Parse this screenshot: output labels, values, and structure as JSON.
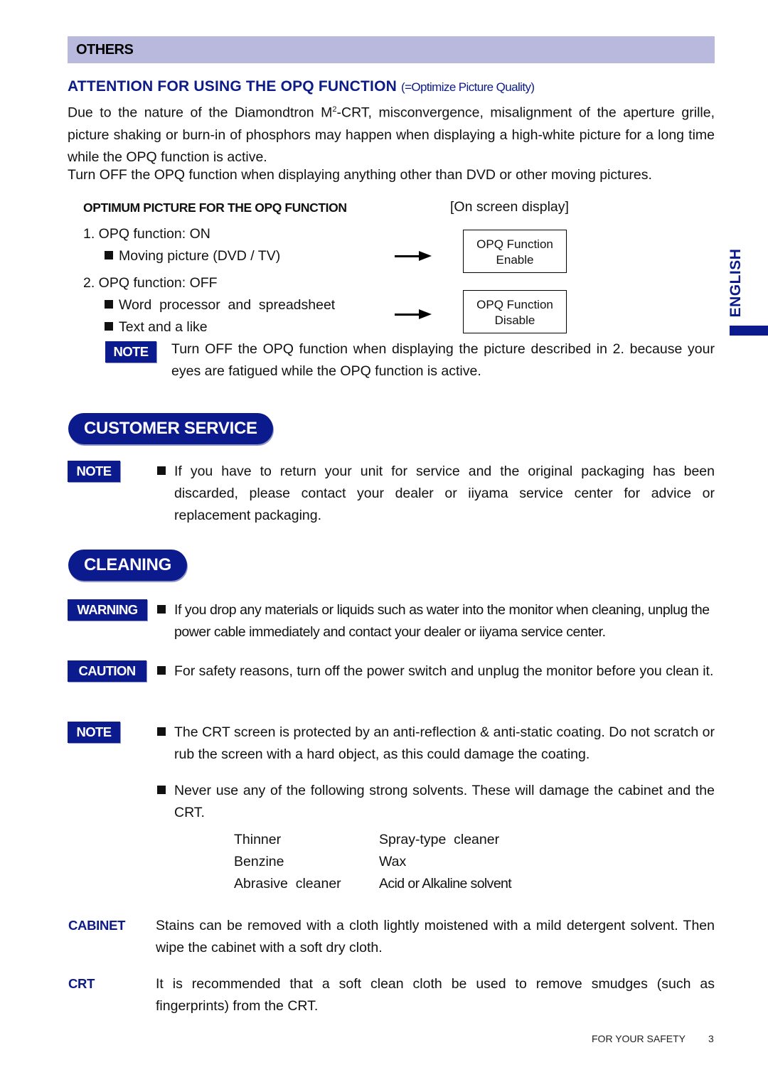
{
  "section": {
    "title": "OTHERS"
  },
  "attention": {
    "title": "ATTENTION FOR USING THE OPQ FUNCTION",
    "subtitle": "(=Optimize Picture Quality)",
    "para1_line1_pre": "Due to the nature of the Diamondtron M",
    "para1_sup": "2",
    "para1_line1_post": "-CRT, misconvergence, misalignment of the aperture grille, picture shaking or burn-in of phosphors may happen when displaying a high-white picture for a long time while the OPQ function is active.",
    "para2": "Turn OFF the OPQ function when displaying anything other than DVD or other moving pictures."
  },
  "optimum": {
    "heading": "OPTIMUM PICTURE FOR THE OPQ FUNCTION",
    "osd_label": "[On screen display]",
    "items": [
      {
        "title": "1.  OPQ function: ON",
        "bullets": [
          "Moving picture (DVD / TV)"
        ],
        "osd_line1": "OPQ Function",
        "osd_line2": "Enable"
      },
      {
        "title": "2.  OPQ function: OFF",
        "bullets": [
          "Word  processor  and  spreadsheet",
          "Text and a like"
        ],
        "osd_line1": "OPQ Function",
        "osd_line2": "Disable"
      }
    ],
    "note_label": "NOTE",
    "note_text": "Turn OFF the OPQ function when displaying the picture described in 2. because your eyes are fatigued while the OPQ function is active."
  },
  "side_tab": {
    "label": "ENGLISH"
  },
  "customer_service": {
    "title": "CUSTOMER SERVICE",
    "note_label": "NOTE",
    "text": "If you have to return your unit for service and the original packaging has been discarded, please contact your dealer or iiyama service center for advice or replacement packaging."
  },
  "cleaning": {
    "title": "CLEANING",
    "warning_label": "WARNING",
    "warning_text": "If you drop any materials or liquids such as water into the monitor when cleaning, unplug the power cable immediately and contact your dealer or iiyama service center.",
    "caution_label": "CAUTION",
    "caution_text": "For safety reasons, turn off the power switch and unplug the monitor before you clean it.",
    "note_label": "NOTE",
    "note_text1": "The CRT screen is protected by an anti-reflection & anti-static coating. Do not scratch or rub the screen with a hard object, as this could damage the coating.",
    "note_text2": "Never use any of the following strong solvents. These will damage the cabinet and the CRT.",
    "solvents": [
      [
        "Thinner",
        "Spray-type  cleaner"
      ],
      [
        "Benzine",
        "Wax"
      ],
      [
        "Abrasive  cleaner",
        "Acid or Alkaline solvent"
      ]
    ],
    "cabinet_label": "CABINET",
    "cabinet_text": "Stains can be removed with a cloth lightly moistened with a mild detergent solvent. Then wipe the cabinet with a soft dry cloth.",
    "crt_label": "CRT",
    "crt_text": "It is recommended that a soft clean cloth be used to remove smudges (such as fingerprints) from the CRT."
  },
  "footer": {
    "section": "FOR YOUR SAFETY",
    "page": "3"
  },
  "colors": {
    "accent": "#0b1a8c",
    "section_bar": "#b8b9dc"
  }
}
